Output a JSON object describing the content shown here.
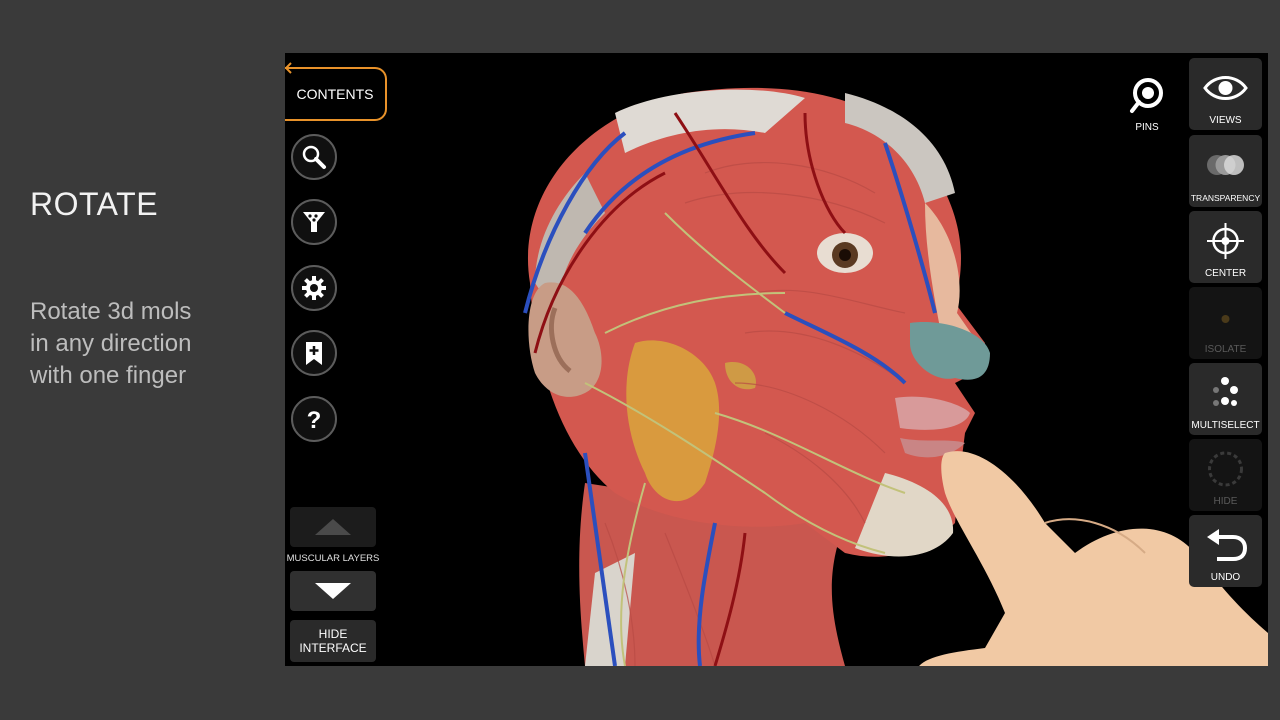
{
  "slide": {
    "title": "ROTATE",
    "description_lines": [
      "Rotate 3d mols",
      "in any direction",
      "with one finger"
    ]
  },
  "app": {
    "left_toolbar": {
      "contents_label": "CONTENTS",
      "icons": [
        "search-icon",
        "filter-icon",
        "gear-icon",
        "bookmark-add-icon",
        "help-icon"
      ],
      "layers_label": "MUSCULAR LAYERS",
      "hide_interface_line1": "HIDE",
      "hide_interface_line2": "INTERFACE"
    },
    "pins_label": "PINS",
    "right_toolbar": {
      "views": "VIEWS",
      "transparency": "TRANSPARENCY",
      "center": "CENTER",
      "isolate": "ISOLATE",
      "multiselect": "MULTISELECT",
      "hide": "HIDE",
      "undo": "UNDO"
    },
    "accent_color": "#e8922a",
    "model": "3d-head-anatomy-muscles-vessels-nerves"
  }
}
